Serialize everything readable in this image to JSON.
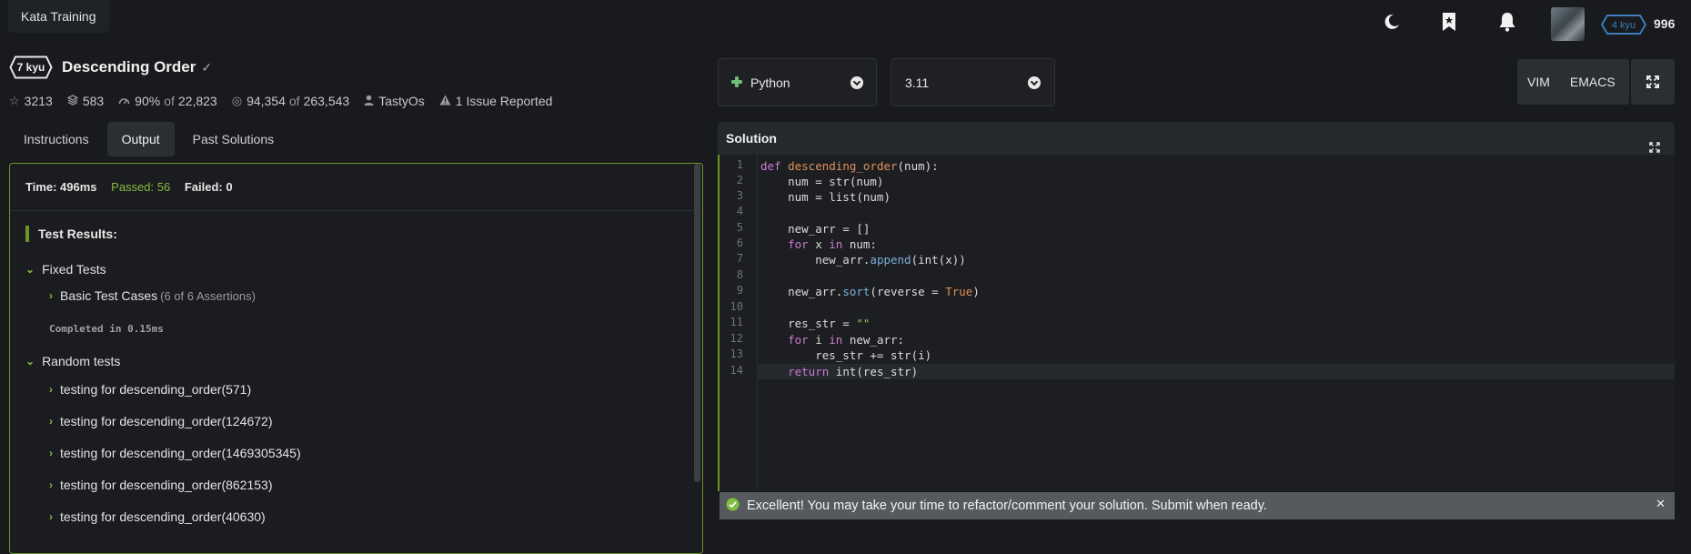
{
  "header": {
    "kata_training": "Kata Training",
    "rank": "4 kyu",
    "honor": "996"
  },
  "kata": {
    "rank": "7 kyu",
    "title": "Descending Order",
    "stats": {
      "stars": "3213",
      "collections": "583",
      "satisfaction": "90%",
      "of1": "of",
      "votes": "22,823",
      "completed": "94,354",
      "of2": "of",
      "attempts": "263,543",
      "author": "TastyOs",
      "issues": "1 Issue Reported"
    }
  },
  "tabs": [
    "Instructions",
    "Output",
    "Past Solutions"
  ],
  "output": {
    "time": "Time: 496ms",
    "passed": "Passed: 56",
    "failed": "Failed: 0",
    "results_title": "Test Results:",
    "fixed_tests": "Fixed Tests",
    "basic_test_cases": "Basic Test Cases",
    "basic_assertions": "(6 of 6 Assertions)",
    "completed": "Completed in 0.15ms",
    "random_tests": "Random tests",
    "random_items": [
      "testing for descending_order(571)",
      "testing for descending_order(124672)",
      "testing for descending_order(1469305345)",
      "testing for descending_order(862153)",
      "testing for descending_order(40630)"
    ]
  },
  "editor": {
    "language": "Python",
    "version": "3.11",
    "mode_vim": "VIM",
    "mode_emacs": "EMACS",
    "solution_label": "Solution",
    "line_numbers": [
      "1",
      "2",
      "3",
      "4",
      "5",
      "6",
      "7",
      "8",
      "9",
      "10",
      "11",
      "12",
      "13",
      "14"
    ]
  },
  "success_message": "Excellent! You may take your time to refactor/comment your solution. Submit when ready.",
  "colors": {
    "accent_green": "#6b9624",
    "passed_green": "#83bd3f",
    "rank_blue": "#3c7ebb"
  }
}
